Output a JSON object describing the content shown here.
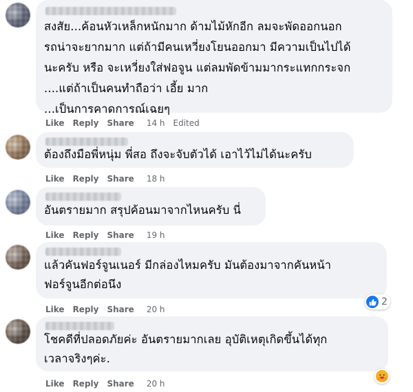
{
  "comments": [
    {
      "text": "สงสัย...ค้อนหัวเหล็กหนักมาก ด้ามไม้หักอีก ลมจะพัดออกนอก\nรถน่าจะยากมาก แต่ถ้ามีคนเหวี่ยงโยนออกมา มีความเป็นไปได้\nนะครับ หรือ จะเหวี่ยงใส่ฟอจูน แต่ลมพัดข้ามมากระแทกกระจก\n....แต่ถ้าเป็นคนทำถือว่า เอี้ย มาก\n...เป็นการคาดการณ์เฉยๆ",
      "like": "Like",
      "reply": "Reply",
      "share": "Share",
      "time": "14 h",
      "edited": "Edited",
      "avatar_colors": [
        "#8a8fa3",
        "#4b5061"
      ]
    },
    {
      "text": "ต้องถึงมือพี่หนุ่ม พี่สอ ถึงจะจับตัวได้ เอาไว้ไม่ได้นะครับ",
      "like": "Like",
      "reply": "Reply",
      "share": "Share",
      "time": "18 h",
      "avatar_colors": [
        "#c9a27a",
        "#6e5a48"
      ]
    },
    {
      "text": "อันตรายมาก สรุปค้อนมาจากไหนครับ นี่",
      "like": "Like",
      "reply": "Reply",
      "share": "Share",
      "time": "19 h",
      "avatar_colors": [
        "#a3b0c8",
        "#5c6580"
      ]
    },
    {
      "text": "แล้วคันฟอร์จูนเนอร์ มีกล่องไหมครับ มันต้องมาจากคันหน้า\nฟอร์จูนอีกต่อนึง",
      "like": "Like",
      "reply": "Reply",
      "share": "Share",
      "time": "20 h",
      "reaction_count": "2",
      "reaction_icon": "like-icon",
      "avatar_colors": [
        "#b09b8e",
        "#4e3f38"
      ]
    },
    {
      "text": "โชคดีที่ปลอดภัยค่ะ อันตรายมากเลย อุบัติเหตุเกิดขึ้นได้ทุก\nเวลาจริงๆค่ะ.",
      "like": "Like",
      "reply": "Reply",
      "share": "Share",
      "time": "20 h",
      "reaction_icon": "care-icon",
      "avatar_colors": [
        "#9a8a7c",
        "#3e3530"
      ]
    }
  ]
}
